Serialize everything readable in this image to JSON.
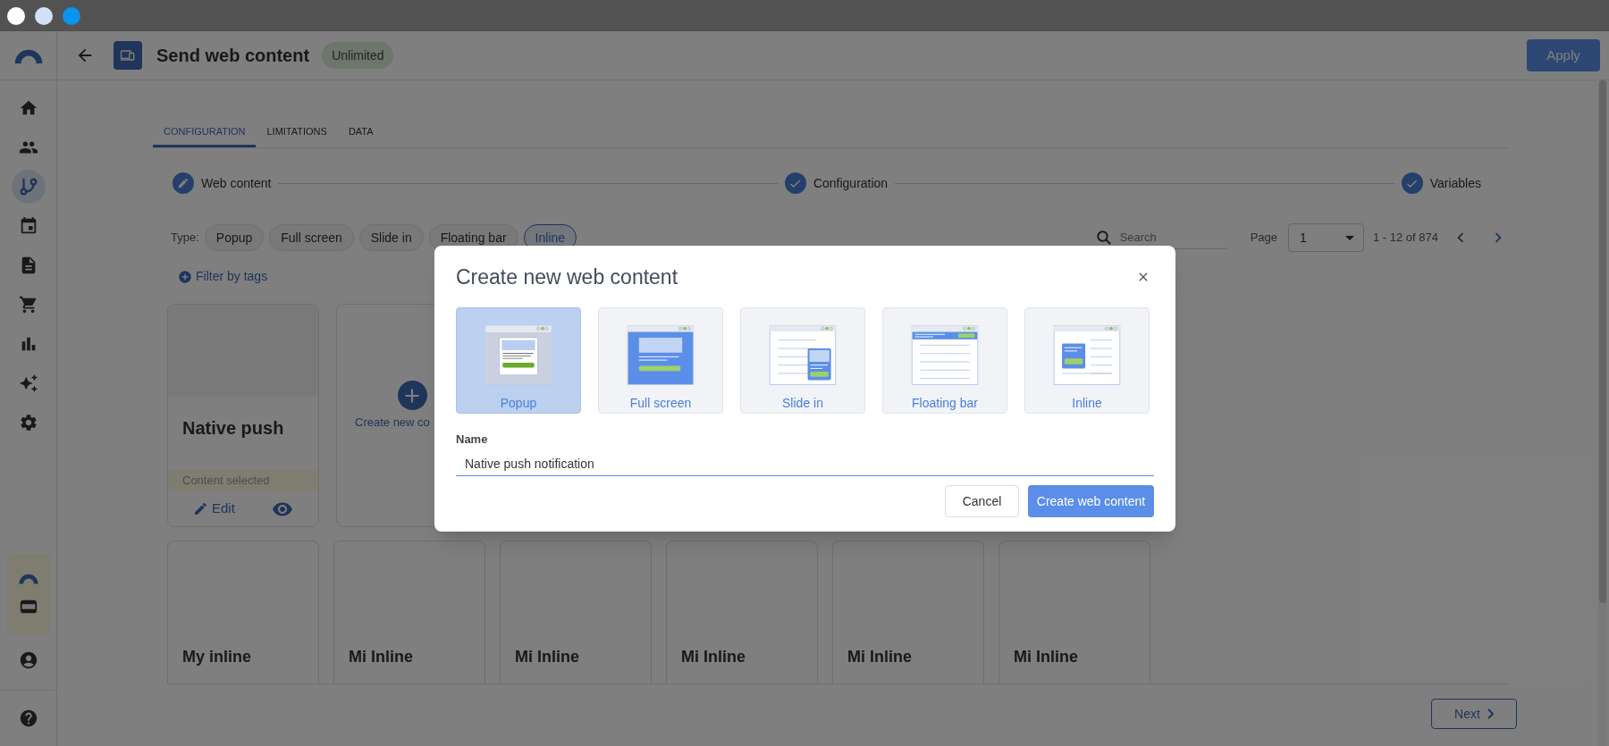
{
  "header": {
    "title": "Send web content",
    "badge": "Unlimited",
    "apply": "Apply"
  },
  "sidebar": {
    "items": [
      {
        "selected": false
      },
      {
        "selected": false
      },
      {
        "selected": true
      },
      {
        "selected": false
      },
      {
        "selected": false
      },
      {
        "selected": false
      },
      {
        "selected": false
      },
      {
        "selected": false
      },
      {
        "selected": false
      }
    ]
  },
  "tabs": [
    {
      "label": "CONFIGURATION",
      "selected": true
    },
    {
      "label": "LIMITATIONS",
      "selected": false
    },
    {
      "label": "DATA",
      "selected": false
    }
  ],
  "steps": [
    {
      "label": "Web content",
      "kind": "edit"
    },
    {
      "label": "Configuration",
      "kind": "done"
    },
    {
      "label": "Variables",
      "kind": "done"
    }
  ],
  "type_filter": {
    "label": "Type:",
    "options": [
      {
        "label": "Popup",
        "selected": false
      },
      {
        "label": "Full screen",
        "selected": false
      },
      {
        "label": "Slide in",
        "selected": false
      },
      {
        "label": "Floating bar",
        "selected": false
      },
      {
        "label": "Inline",
        "selected": true
      }
    ]
  },
  "search": {
    "placeholder": "Search"
  },
  "pagination": {
    "label": "Page",
    "value": "1",
    "range": "1 - 12 of 874"
  },
  "filter_by_tags": "Filter by tags",
  "selected_card": {
    "title": "Native push",
    "status": "Content selected",
    "edit": "Edit"
  },
  "create_card": {
    "label": "Create new co"
  },
  "cards": [
    {
      "title": "My inline"
    },
    {
      "title": "Mi Inline"
    },
    {
      "title": "Mi Inline"
    },
    {
      "title": "Mi Inline"
    },
    {
      "title": "Mi Inline"
    },
    {
      "title": "Mi Inline"
    }
  ],
  "next": "Next",
  "dialog": {
    "title": "Create new web content",
    "options": [
      {
        "label": "Popup",
        "kind": "popup",
        "selected": true
      },
      {
        "label": "Full screen",
        "kind": "fullscreen",
        "selected": false
      },
      {
        "label": "Slide in",
        "kind": "slidein",
        "selected": false
      },
      {
        "label": "Floating bar",
        "kind": "floatingbar",
        "selected": false
      },
      {
        "label": "Inline",
        "kind": "inline",
        "selected": false
      }
    ],
    "name_label": "Name",
    "name_value": "Native push notification",
    "cancel": "Cancel",
    "create": "Create web content"
  }
}
